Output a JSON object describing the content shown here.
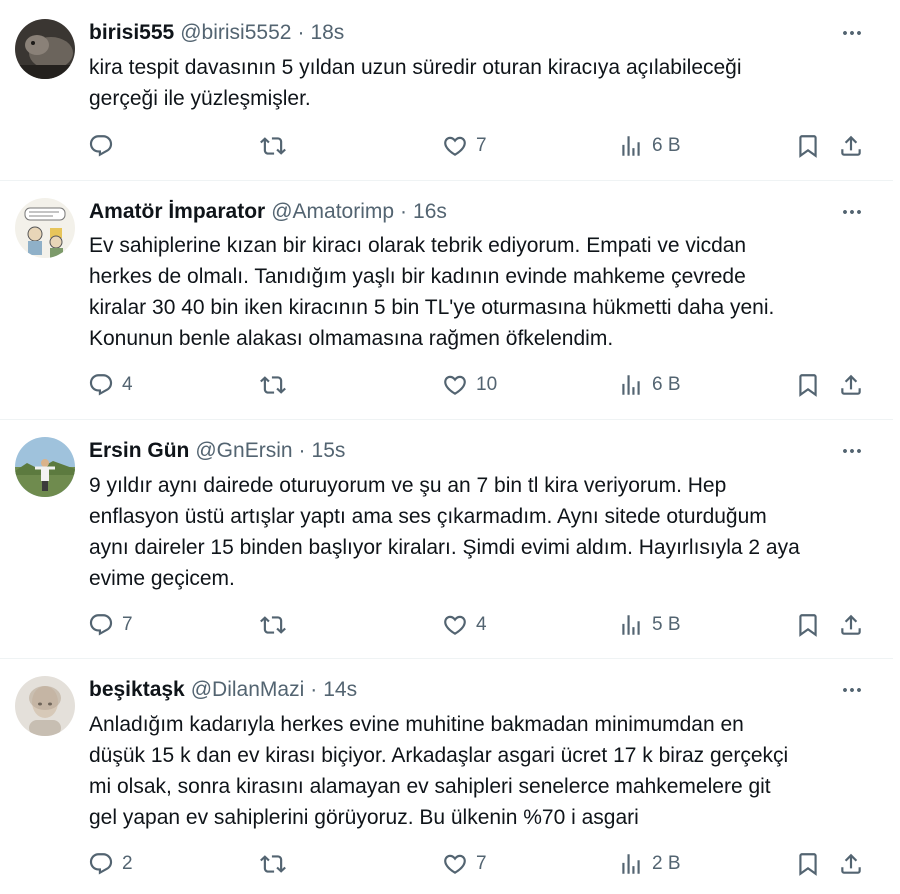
{
  "tweets": [
    {
      "name": "birisi555",
      "handle": "@birisi5552",
      "time": "18s",
      "lines": [
        "kira tespit davasının 5 yıldan uzun süredir oturan kiracıya açılabileceği",
        "gerçeği ile yüzleşmişler."
      ],
      "replies": "",
      "retweets": "",
      "likes": "7",
      "views": "6 B",
      "avatar_icon": "dark-photo-avatar"
    },
    {
      "name": "Amatör İmparator",
      "handle": "@Amatorimp",
      "time": "16s",
      "lines": [
        "Ev sahiplerine kızan bir kiracı olarak tebrik ediyorum. Empati ve vicdan",
        "herkes de olmalı. Tanıdığım yaşlı bir kadının evinde mahkeme  çevrede",
        "kiralar 30 40 bin iken kiracının 5 bin TL'ye oturmasına hükmetti daha yeni.",
        "Konunun benle alakası olmamasına rağmen öfkelendim."
      ],
      "replies": "4",
      "retweets": "",
      "likes": "10",
      "views": "6 B",
      "avatar_icon": "cartoon-avatar"
    },
    {
      "name": "Ersin Gün",
      "handle": "@GnErsin",
      "time": "15s",
      "lines": [
        "9 yıldır aynı dairede oturuyorum ve şu an 7 bin tl kira veriyorum. Hep",
        "enflasyon üstü artışlar yaptı ama ses çıkarmadım. Aynı sitede oturduğum",
        "aynı daireler 15 binden başlıyor kiraları. Şimdi evimi aldım. Hayırlısıyla 2 aya",
        "evime geçicem."
      ],
      "replies": "7",
      "retweets": "",
      "likes": "4",
      "views": "5 B",
      "avatar_icon": "landscape-person-avatar"
    },
    {
      "name": "beşiktaşk",
      "handle": "@DilanMazi",
      "time": "14s",
      "lines": [
        "Anladığım kadarıyla herkes evine muhitine bakmadan minimumdan en",
        "düşük 15 k dan ev kirası biçiyor. Arkadaşlar asgari ücret 17 k biraz gerçekçi",
        "mi olsak, sonra kirasını alamayan ev sahipleri senelerce mahkemelere git",
        "gel yapan ev sahiplerini görüyoruz. Bu ülkenin %70 i asgari"
      ],
      "replies": "2",
      "retweets": "",
      "likes": "7",
      "views": "2 B",
      "avatar_icon": "blurred-portrait-avatar"
    }
  ],
  "colors": {
    "text": "#0f1419",
    "muted": "#536471",
    "divider": "#eff3f4",
    "background": "#ffffff"
  },
  "icons": [
    "reply-icon",
    "retweet-icon",
    "like-icon",
    "views-icon",
    "bookmark-icon",
    "share-icon",
    "more-icon"
  ]
}
